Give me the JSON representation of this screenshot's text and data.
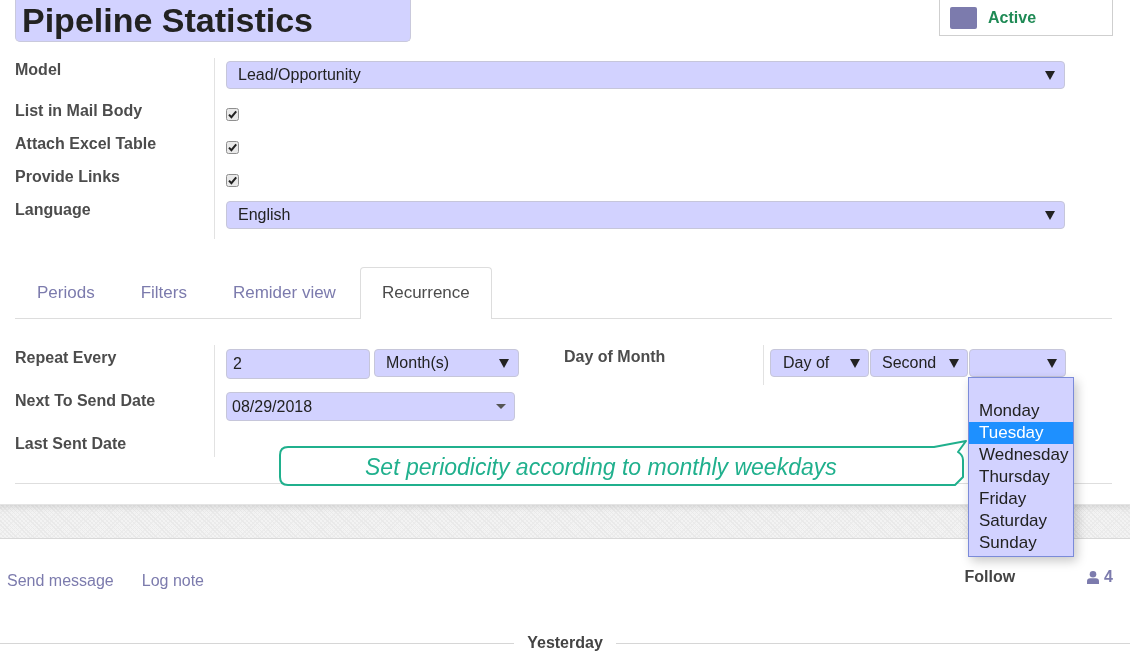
{
  "record": {
    "title": "Pipeline Statistics",
    "status": {
      "label": "Active"
    }
  },
  "fields": [
    {
      "kind": "select",
      "label": "Model",
      "value": "Lead/Opportunity"
    },
    {
      "kind": "checkbox",
      "label": "List in Mail Body",
      "checked": true
    },
    {
      "kind": "checkbox",
      "label": "Attach Excel Table",
      "checked": true
    },
    {
      "kind": "checkbox",
      "label": "Provide Links",
      "checked": true
    },
    {
      "kind": "select",
      "label": "Language",
      "value": "English"
    }
  ],
  "tabs": [
    {
      "label": "Periods",
      "selected": false
    },
    {
      "label": "Filters",
      "selected": false
    },
    {
      "label": "Remider view",
      "selected": false
    },
    {
      "label": "Recurrence",
      "selected": true
    }
  ],
  "recurrence": {
    "fields": [
      {
        "kind": "interval",
        "label": "Repeat Every",
        "value": "2",
        "unit": "Month(s)"
      },
      {
        "kind": "date",
        "label": "Next To Send Date",
        "value": "08/29/2018"
      },
      {
        "kind": "empty",
        "label": "Last Sent Date"
      }
    ],
    "day_of_month": {
      "label": "Day of Month",
      "selects": [
        {
          "value": "Day of",
          "open": false
        },
        {
          "value": "Second",
          "open": false
        },
        {
          "open": true,
          "has_blank_option": true,
          "options": [
            {
              "label": "Monday",
              "selected": false
            },
            {
              "label": "Tuesday",
              "selected": true
            },
            {
              "label": "Wednesday",
              "selected": false
            },
            {
              "label": "Thursday",
              "selected": false
            },
            {
              "label": "Friday",
              "selected": false
            },
            {
              "label": "Saturday",
              "selected": false
            },
            {
              "label": "Sunday",
              "selected": false
            }
          ]
        }
      ]
    },
    "callout": {
      "text": "Set periodicity according to monthly weekdays"
    }
  },
  "chatter": {
    "actions": [
      {
        "label": "Send message"
      },
      {
        "label": "Log note"
      }
    ],
    "follow": {
      "label": "Follow"
    },
    "followers": {
      "count": "4"
    }
  },
  "date_separator": {
    "label": "Yesterday"
  }
}
